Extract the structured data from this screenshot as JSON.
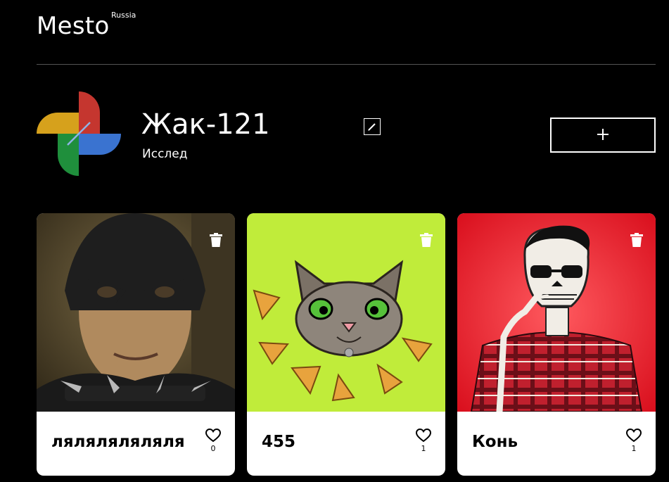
{
  "header": {
    "logo": "Mesto",
    "logo_sup": "Russia"
  },
  "profile": {
    "name": "Жак-121",
    "about": "Исслед",
    "avatar_icon": "pinwheel-avatar",
    "edit_icon": "pencil-icon",
    "add_icon": "plus-icon"
  },
  "cards": [
    {
      "title": "ляляляляляля",
      "likes": "0",
      "image": "masked-person-photo"
    },
    {
      "title": "455",
      "likes": "1",
      "image": "cat-with-pizza-illustration"
    },
    {
      "title": "Конь",
      "likes": "1",
      "image": "skeleton-in-plaid-shirt-illustration"
    }
  ],
  "colors": {
    "background": "#000000",
    "card": "#ffffff",
    "divider": "#545454"
  }
}
